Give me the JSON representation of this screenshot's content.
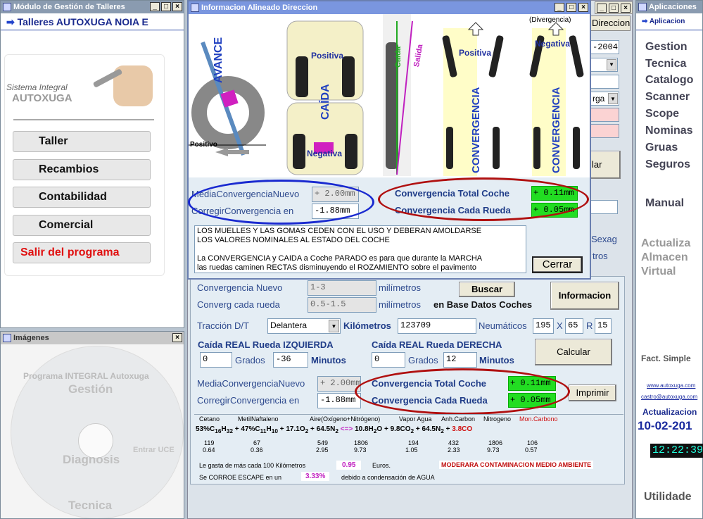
{
  "left_window": {
    "title": "Módulo de Gestión de Talleres",
    "header": "Talleres AUTOXUGA NOIA E",
    "brand_line1": "Sistema Integral",
    "brand_line2": "AUTOXUGA",
    "buttons": [
      "Taller",
      "Recambios",
      "Contabilidad",
      "Comercial",
      "Salir del programa"
    ]
  },
  "images_window": {
    "title": "Imágenes",
    "watermarks": [
      "Programa INTEGRAL Autoxuga",
      "Gestión",
      "Diagnosis",
      "Tecnica",
      "Entrar UCE"
    ]
  },
  "info_window": {
    "title": "Informacion Alineado Direccion",
    "diagram_labels": {
      "avance": "AVANCE",
      "positivo_small": "Positivo",
      "positiva": "Positiva",
      "caida": "CAÍDA",
      "negativa": "Negativa",
      "caida_small": "Caída",
      "salida": "Salida",
      "divergencia": "(Divergencia)",
      "positiva2": "Positiva",
      "negativa2": "Negativa",
      "convergencia": "CONVERGENCIA"
    },
    "media_label": "MediaConvergenciaNuevo",
    "media_value": "+ 2.00mm",
    "corregir_label": "CorregirConvergencia en",
    "corregir_value": "-1.88mm",
    "total_label": "Convergencia Total Coche",
    "total_value": "+ 0.11mm",
    "rueda_label": "Convergencia Cada Rueda",
    "rueda_value": "+ 0.05mm",
    "note_line1": "LOS MUELLES Y LAS GOMAS CEDEN CON EL USO Y DEBERAN AMOLDARSE",
    "note_line2": "LOS VALORES NOMINALES AL ESTADO DEL COCHE",
    "note_line3": "La CONVERGENCIA y CAIDA a Coche PARADO es para que durante la MARCHA",
    "note_line4": "las ruedas caminen RECTAS disminuyendo el ROZAMIENTO sobre el pavimento",
    "close_label": "Cerrar"
  },
  "back_form": {
    "tab_label": "Direccion",
    "date_text": "-2004",
    "select_text": "rga",
    "button_text": "lar",
    "sexag": "Sexag",
    "metros": "tros",
    "conv_nuevo_label": "Convergencia Nuevo",
    "conv_nuevo_value": "1-3",
    "conv_rueda_label": "Converg cada rueda",
    "conv_rueda_value": "0.5-1.5",
    "milimetros": "milímetros",
    "buscar": "Buscar",
    "base_datos": "en Base Datos Coches",
    "informacion": "Informacion",
    "traccion_label": "Tracción D/T",
    "traccion_value": "Delantera",
    "km_label": "Kilómetros",
    "km_value": "123709",
    "neum_label": "Neumáticos",
    "neum_w": "195",
    "neum_x": "X",
    "neum_h": "65",
    "neum_r": "R",
    "neum_d": "15",
    "caida_izq": "Caída REAL Rueda IZQUIERDA",
    "caida_der": "Caída REAL Rueda DERECHA",
    "izq_grados": "0",
    "grados": "Grados",
    "izq_minutos": "-36",
    "minutos": "Minutos",
    "der_grados": "0",
    "der_minutos": "12",
    "calcular": "Calcular",
    "media_label": "MediaConvergenciaNuevo",
    "media_value": "+ 2.00mm",
    "corregir_label": "CorregirConvergencia en",
    "corregir_value": "-1.88mm",
    "total_label": "Convergencia Total Coche",
    "total_value": "+ 0.11mm",
    "rueda_label": "Convergencia Cada Rueda",
    "rueda_value": "+ 0.05mm",
    "imprimir": "Imprimir",
    "chem_headers": [
      "Cetano",
      "MetilNaftaleno",
      "Aire(Oxígeno+Nitrógeno)",
      "Vapor Agua",
      "Anh.Carbon",
      "Nitrogeno",
      "Mon.Carbono"
    ],
    "chem_row1": [
      "119",
      "67",
      "549",
      "1806",
      "194",
      "432",
      "1806",
      "106"
    ],
    "chem_row2": [
      "0.64",
      "0.36",
      "2.95",
      "9.73",
      "1.05",
      "2.33",
      "9.73",
      "0.57"
    ],
    "gasta_text": "Le gasta de más cada 100 Kilómetros",
    "gasta_value": "0.95",
    "euros": "Euros.",
    "moderara": "MODERARA CONTAMINACION MEDIO AMBIENTE",
    "corroe_text": "Se CORROE ESCAPE en un",
    "corroe_value": "3.33%",
    "corroe_tail": "debido a condensación de AGUA"
  },
  "right_window": {
    "title": "Aplicaciones",
    "header": "Aplicacion",
    "menu": [
      "Gestion",
      "Tecnica",
      "Catalogo",
      "Scanner",
      "Scope",
      "Nominas",
      "Gruas",
      "Seguros"
    ],
    "manual": "Manual",
    "actualiza": [
      "Actualiza",
      "Almacen",
      "Virtual"
    ],
    "fact": "Fact. Simple",
    "link1": "www.autoxuga.com",
    "link2": "castro@autoxuga.com",
    "actualizacion": "Actualizacion",
    "date": "10-02-201",
    "clock": "12:22:39",
    "utilidades": "Utilidade"
  },
  "colors": {
    "title_active": "#7a96df",
    "green_value": "#22dd22",
    "oval_red": "#b01010",
    "oval_blue": "#1a2ad0",
    "form_bg": "#e4edf4",
    "label_blue": "#2e4a8e"
  }
}
